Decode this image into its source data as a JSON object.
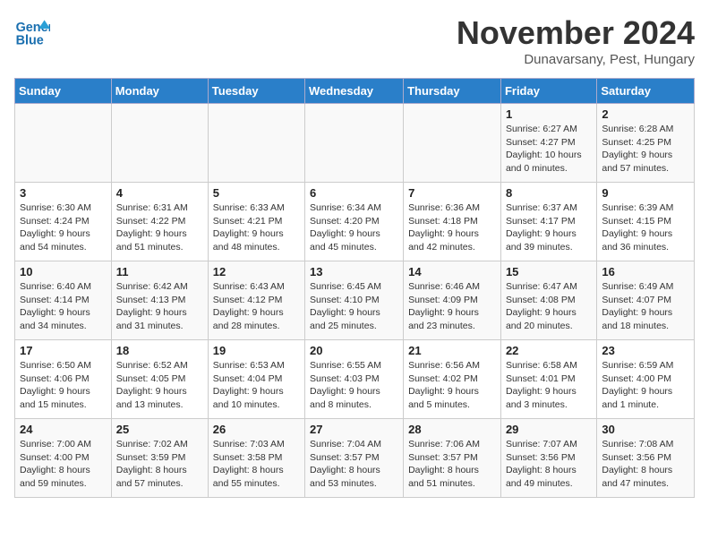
{
  "logo": {
    "line1": "General",
    "line2": "Blue"
  },
  "title": "November 2024",
  "subtitle": "Dunavarsany, Pest, Hungary",
  "weekdays": [
    "Sunday",
    "Monday",
    "Tuesday",
    "Wednesday",
    "Thursday",
    "Friday",
    "Saturday"
  ],
  "weeks": [
    [
      {
        "day": "",
        "info": ""
      },
      {
        "day": "",
        "info": ""
      },
      {
        "day": "",
        "info": ""
      },
      {
        "day": "",
        "info": ""
      },
      {
        "day": "",
        "info": ""
      },
      {
        "day": "1",
        "info": "Sunrise: 6:27 AM\nSunset: 4:27 PM\nDaylight: 10 hours\nand 0 minutes."
      },
      {
        "day": "2",
        "info": "Sunrise: 6:28 AM\nSunset: 4:25 PM\nDaylight: 9 hours\nand 57 minutes."
      }
    ],
    [
      {
        "day": "3",
        "info": "Sunrise: 6:30 AM\nSunset: 4:24 PM\nDaylight: 9 hours\nand 54 minutes."
      },
      {
        "day": "4",
        "info": "Sunrise: 6:31 AM\nSunset: 4:22 PM\nDaylight: 9 hours\nand 51 minutes."
      },
      {
        "day": "5",
        "info": "Sunrise: 6:33 AM\nSunset: 4:21 PM\nDaylight: 9 hours\nand 48 minutes."
      },
      {
        "day": "6",
        "info": "Sunrise: 6:34 AM\nSunset: 4:20 PM\nDaylight: 9 hours\nand 45 minutes."
      },
      {
        "day": "7",
        "info": "Sunrise: 6:36 AM\nSunset: 4:18 PM\nDaylight: 9 hours\nand 42 minutes."
      },
      {
        "day": "8",
        "info": "Sunrise: 6:37 AM\nSunset: 4:17 PM\nDaylight: 9 hours\nand 39 minutes."
      },
      {
        "day": "9",
        "info": "Sunrise: 6:39 AM\nSunset: 4:15 PM\nDaylight: 9 hours\nand 36 minutes."
      }
    ],
    [
      {
        "day": "10",
        "info": "Sunrise: 6:40 AM\nSunset: 4:14 PM\nDaylight: 9 hours\nand 34 minutes."
      },
      {
        "day": "11",
        "info": "Sunrise: 6:42 AM\nSunset: 4:13 PM\nDaylight: 9 hours\nand 31 minutes."
      },
      {
        "day": "12",
        "info": "Sunrise: 6:43 AM\nSunset: 4:12 PM\nDaylight: 9 hours\nand 28 minutes."
      },
      {
        "day": "13",
        "info": "Sunrise: 6:45 AM\nSunset: 4:10 PM\nDaylight: 9 hours\nand 25 minutes."
      },
      {
        "day": "14",
        "info": "Sunrise: 6:46 AM\nSunset: 4:09 PM\nDaylight: 9 hours\nand 23 minutes."
      },
      {
        "day": "15",
        "info": "Sunrise: 6:47 AM\nSunset: 4:08 PM\nDaylight: 9 hours\nand 20 minutes."
      },
      {
        "day": "16",
        "info": "Sunrise: 6:49 AM\nSunset: 4:07 PM\nDaylight: 9 hours\nand 18 minutes."
      }
    ],
    [
      {
        "day": "17",
        "info": "Sunrise: 6:50 AM\nSunset: 4:06 PM\nDaylight: 9 hours\nand 15 minutes."
      },
      {
        "day": "18",
        "info": "Sunrise: 6:52 AM\nSunset: 4:05 PM\nDaylight: 9 hours\nand 13 minutes."
      },
      {
        "day": "19",
        "info": "Sunrise: 6:53 AM\nSunset: 4:04 PM\nDaylight: 9 hours\nand 10 minutes."
      },
      {
        "day": "20",
        "info": "Sunrise: 6:55 AM\nSunset: 4:03 PM\nDaylight: 9 hours\nand 8 minutes."
      },
      {
        "day": "21",
        "info": "Sunrise: 6:56 AM\nSunset: 4:02 PM\nDaylight: 9 hours\nand 5 minutes."
      },
      {
        "day": "22",
        "info": "Sunrise: 6:58 AM\nSunset: 4:01 PM\nDaylight: 9 hours\nand 3 minutes."
      },
      {
        "day": "23",
        "info": "Sunrise: 6:59 AM\nSunset: 4:00 PM\nDaylight: 9 hours\nand 1 minute."
      }
    ],
    [
      {
        "day": "24",
        "info": "Sunrise: 7:00 AM\nSunset: 4:00 PM\nDaylight: 8 hours\nand 59 minutes."
      },
      {
        "day": "25",
        "info": "Sunrise: 7:02 AM\nSunset: 3:59 PM\nDaylight: 8 hours\nand 57 minutes."
      },
      {
        "day": "26",
        "info": "Sunrise: 7:03 AM\nSunset: 3:58 PM\nDaylight: 8 hours\nand 55 minutes."
      },
      {
        "day": "27",
        "info": "Sunrise: 7:04 AM\nSunset: 3:57 PM\nDaylight: 8 hours\nand 53 minutes."
      },
      {
        "day": "28",
        "info": "Sunrise: 7:06 AM\nSunset: 3:57 PM\nDaylight: 8 hours\nand 51 minutes."
      },
      {
        "day": "29",
        "info": "Sunrise: 7:07 AM\nSunset: 3:56 PM\nDaylight: 8 hours\nand 49 minutes."
      },
      {
        "day": "30",
        "info": "Sunrise: 7:08 AM\nSunset: 3:56 PM\nDaylight: 8 hours\nand 47 minutes."
      }
    ]
  ]
}
